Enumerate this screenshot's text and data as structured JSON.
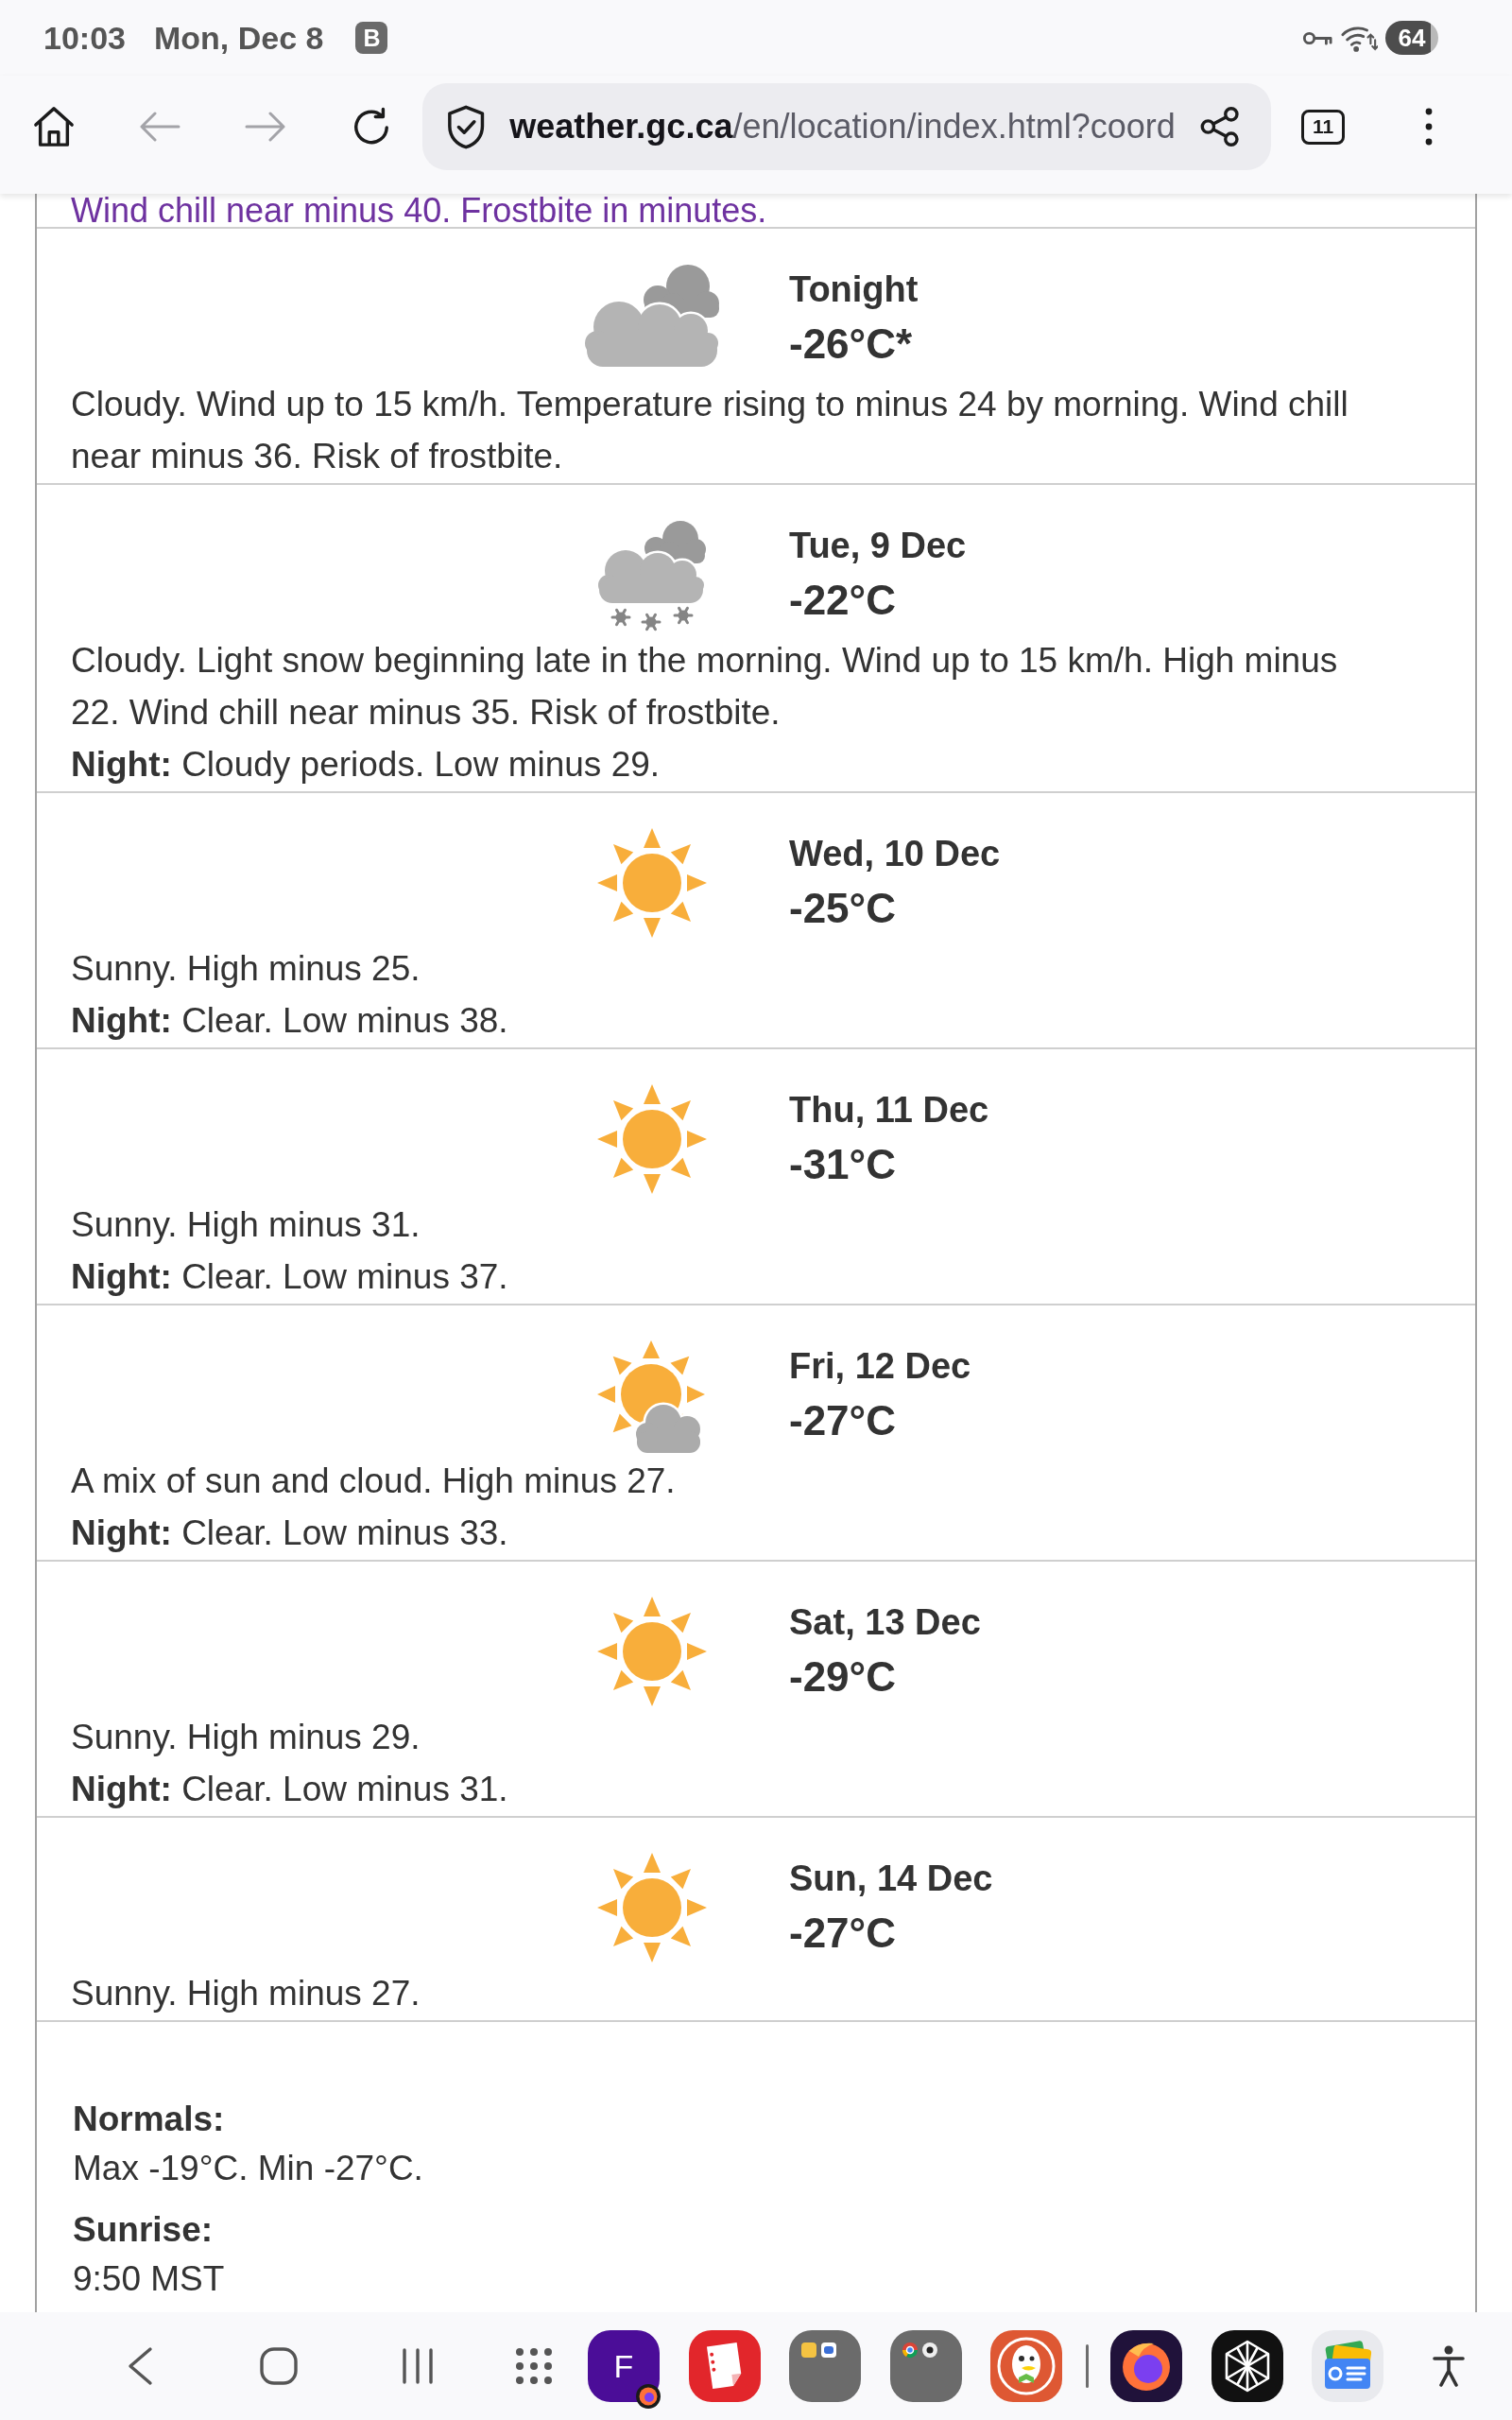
{
  "status_bar": {
    "time": "10:03",
    "date": "Mon, Dec 8",
    "notification": "B",
    "battery": "64"
  },
  "browser": {
    "back": {
      "disabled": true
    },
    "forward": {
      "disabled": true
    },
    "url_host": "weather.gc.ca",
    "url_path": "/en/location/index.html?coord",
    "tab_count": "11"
  },
  "alert": "Wind chill near minus 40. Frostbite in minutes.",
  "forecast": [
    {
      "kind": "cloudy",
      "period": "Tonight",
      "temperature": "-26°C*",
      "summary": "Cloudy. Wind up to 15 km/h. Temperature rising to minus 24 by morning. Wind chill near minus 36. Risk of frostbite."
    },
    {
      "kind": "cloudy_snow",
      "period": "Tue, 9 Dec",
      "temperature": "-22°C",
      "summary": "Cloudy. Light snow beginning late in the morning. Wind up to 15 km/h. High minus 22. Wind chill near minus 35. Risk of frostbite.",
      "night": "**Night:** Cloudy periods. Low minus 29."
    },
    {
      "kind": "sunny",
      "period": "Wed, 10 Dec",
      "temperature": "-25°C",
      "summary": "Sunny. High minus 25.",
      "night": "**Night:** Clear. Low minus 38."
    },
    {
      "kind": "sunny",
      "period": "Thu, 11 Dec",
      "temperature": "-31°C",
      "summary": "Sunny. High minus 31.",
      "night": "**Night:** Clear. Low minus 37."
    },
    {
      "kind": "sun_cloud",
      "period": "Fri, 12 Dec",
      "temperature": "-27°C",
      "summary": "A mix of sun and cloud. High minus 27.",
      "night": "**Night:** Clear. Low minus 33."
    },
    {
      "kind": "sunny",
      "period": "Sat, 13 Dec",
      "temperature": "-29°C",
      "summary": "Sunny. High minus 29.",
      "night": "**Night:** Clear. Low minus 31."
    },
    {
      "kind": "sunny",
      "period": "Sun, 14 Dec",
      "temperature": "-27°C",
      "summary": "Sunny. High minus 27."
    }
  ],
  "details": [
    {
      "label": "Normals:",
      "value": "Max -19°C. Min -27°C."
    },
    {
      "label": "Sunrise:",
      "value": "9:50 MST"
    }
  ],
  "dock": {
    "pinned": [
      {
        "kind": "letter",
        "label": "F"
      },
      {
        "kind": "notes"
      },
      {
        "kind": "folder_docs"
      },
      {
        "kind": "folder_browsers"
      },
      {
        "kind": "duck"
      }
    ],
    "recent": [
      {
        "kind": "fox"
      },
      {
        "kind": "star"
      },
      {
        "kind": "news"
      }
    ]
  }
}
